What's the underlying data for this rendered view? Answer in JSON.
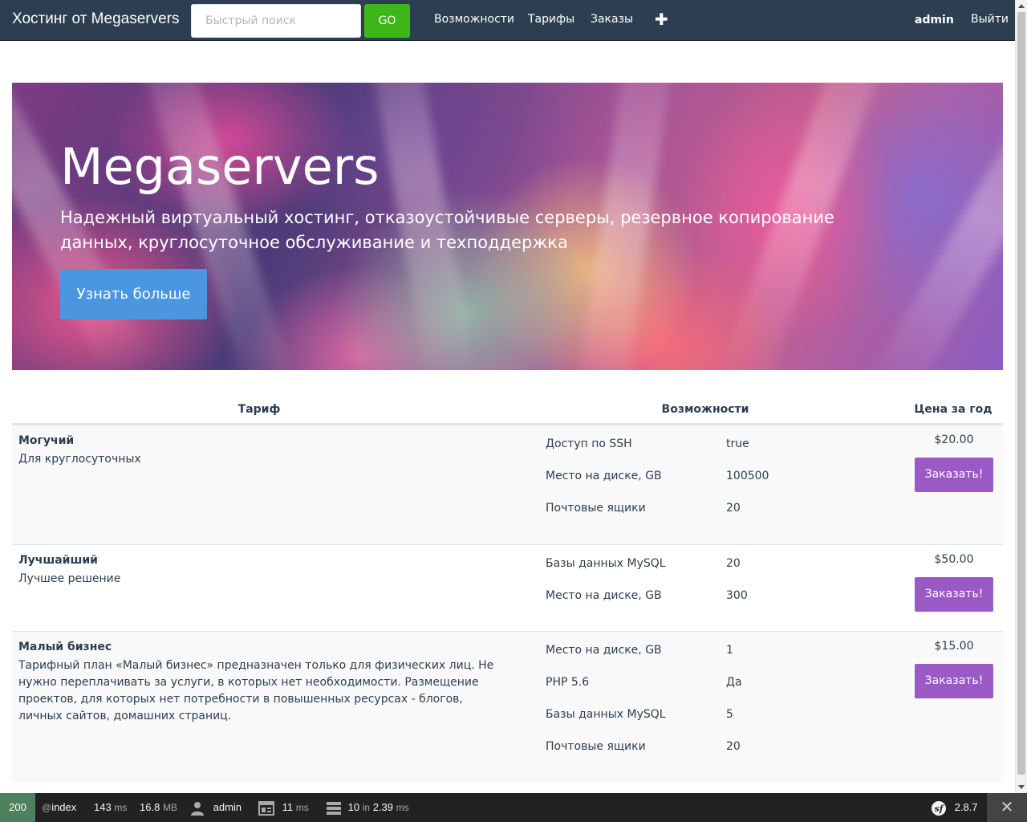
{
  "navbar": {
    "brand": "Хостинг от Megaservers",
    "search_placeholder": "Быстрый поиск",
    "go_label": "GO",
    "links": [
      "Возможности",
      "Тарифы",
      "Заказы"
    ],
    "plus_icon": "plus-icon",
    "user": "admin",
    "logout": "Выйти"
  },
  "hero": {
    "title": "Megaservers",
    "text": "Надежный виртуальный хостинг, отказоустойчивые серверы, резервное копирование данных, круглосуточное обслуживание и техподдержка",
    "button": "Узнать больше"
  },
  "table": {
    "headers": [
      "Тариф",
      "Возможности",
      "Цена за год"
    ],
    "rows": [
      {
        "name": "Могучий",
        "desc": "Для круглосуточных",
        "features": [
          {
            "name": "Доступ по SSH",
            "value": "true"
          },
          {
            "name": "Место на диске, GB",
            "value": "100500"
          },
          {
            "name": "Почтовые ящики",
            "value": "20"
          }
        ],
        "price": "$20.00",
        "button": "Заказать!"
      },
      {
        "name": "Лучшайший",
        "desc": "Лучшее решение",
        "features": [
          {
            "name": "Базы данных MySQL",
            "value": "20"
          },
          {
            "name": "Место на диске, GB",
            "value": "300"
          }
        ],
        "price": "$50.00",
        "button": "Заказать!"
      },
      {
        "name": "Малый бизнес",
        "desc": "Тарифный план «Малый бизнес» предназначен только для физических лиц. Не нужно переплачивать за услуги, в которых нет необходимости. Размещение проектов, для которых нет потребности в повышенных ресурсах - блогов, личных сайтов, домашних страниц.",
        "features": [
          {
            "name": "Место на диске, GB",
            "value": "1"
          },
          {
            "name": "PHP 5.6",
            "value": "Да"
          },
          {
            "name": "Базы данных MySQL",
            "value": "5"
          },
          {
            "name": "Почтовые ящики",
            "value": "20"
          }
        ],
        "price": "$15.00",
        "button": "Заказать!"
      }
    ]
  },
  "toolbar": {
    "status": "200",
    "route_prefix": "@",
    "route": "index",
    "time_value": "143",
    "time_unit": "ms",
    "memory_value": "16.8",
    "memory_unit": "MB",
    "user": "admin",
    "render_value": "11",
    "render_unit": "ms",
    "db_queries": "10",
    "db_in": "in",
    "db_time": "2.39",
    "db_unit": "ms",
    "version": "2.8.7",
    "close_icon": "close-icon"
  },
  "colors": {
    "navbar_bg": "#2c3e50",
    "go_button": "#3fb618",
    "hero_button": "#4a96df",
    "order_button": "#9b59c6",
    "toolbar_bg": "#222222",
    "status_bg": "#4f805d"
  }
}
